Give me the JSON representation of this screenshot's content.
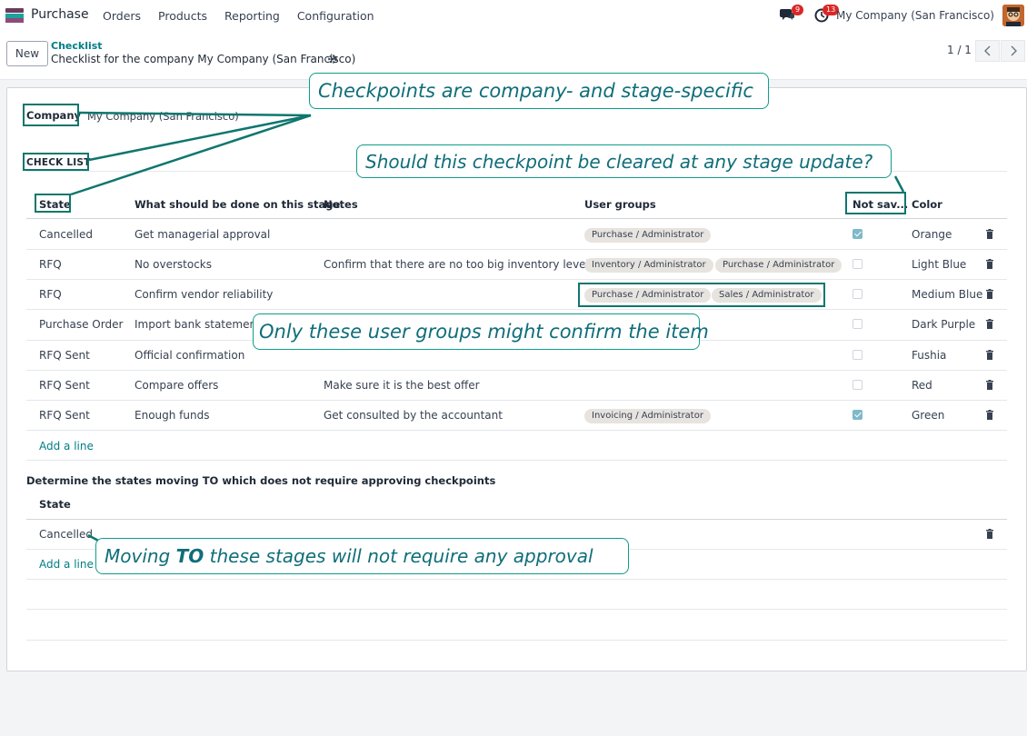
{
  "nav": {
    "app_name": "Purchase",
    "menu": [
      "Orders",
      "Products",
      "Reporting",
      "Configuration"
    ],
    "chat_count": "9",
    "activity_count": "13",
    "company": "My Company (San Francisco)"
  },
  "control": {
    "new_label": "New",
    "breadcrumb": "Checklist",
    "title": "Checklist for the company My Company (San Francisco)",
    "pager": "1 / 1"
  },
  "form": {
    "company_label": "Company",
    "company_value": "My Company (San Francisco)",
    "section_label": "CHECK LIST",
    "headers": {
      "state": "State",
      "todo": "What should be done on this stage",
      "notes": "Notes",
      "groups": "User groups",
      "not_saved": "Not sav...",
      "color": "Color"
    },
    "rows": [
      {
        "state": "Cancelled",
        "todo": "Get managerial approval",
        "notes": "",
        "groups": [
          "Purchase / Administrator"
        ],
        "checked": true,
        "color": "Orange"
      },
      {
        "state": "RFQ",
        "todo": "No overstocks",
        "notes": "Confirm that there are no too big inventory levels",
        "groups": [
          "Inventory / Administrator",
          "Purchase / Administrator"
        ],
        "checked": false,
        "color": "Light Blue"
      },
      {
        "state": "RFQ",
        "todo": "Confirm vendor reliability",
        "notes": "",
        "groups": [
          "Purchase / Administrator",
          "Sales / Administrator"
        ],
        "checked": false,
        "color": "Medium Blue"
      },
      {
        "state": "Purchase Order",
        "todo": "Import bank statement",
        "notes": "",
        "groups": [],
        "checked": false,
        "color": "Dark Purple"
      },
      {
        "state": "RFQ Sent",
        "todo": "Official confirmation",
        "notes": "",
        "groups": [],
        "checked": false,
        "color": "Fushia"
      },
      {
        "state": "RFQ Sent",
        "todo": "Compare offers",
        "notes": "Make sure it is the best offer",
        "groups": [],
        "checked": false,
        "color": "Red"
      },
      {
        "state": "RFQ Sent",
        "todo": "Enough funds",
        "notes": "Get consulted by the accountant",
        "groups": [
          "Invoicing / Administrator"
        ],
        "checked": true,
        "color": "Green"
      }
    ],
    "add_line": "Add a line",
    "states_label": "Determine the states moving TO which does not require approving checkpoints",
    "states_header": "State",
    "states_rows": [
      "Cancelled"
    ],
    "states_add_line": "Add a line"
  },
  "annotations": {
    "callout1": "Checkpoints are company- and stage-specific",
    "callout2": "Should this checkpoint be cleared at any stage update?",
    "callout3": "Only these user groups might confirm the item",
    "callout4_pre": "Moving ",
    "callout4_bold": "TO",
    "callout4_post": " these stages will not require any approval"
  },
  "colors": {
    "accent": "#017e84",
    "annotation": "#0f766e",
    "badge": "#dc2626"
  }
}
